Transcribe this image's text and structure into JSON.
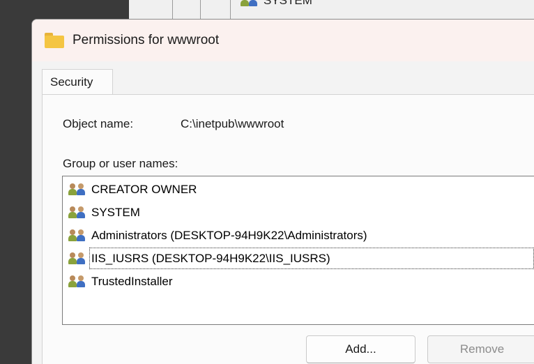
{
  "background": {
    "partial_item": "SYSTEM"
  },
  "dialog": {
    "title": "Permissions for wwwroot",
    "tabs": [
      {
        "label": "Security",
        "active": true
      }
    ],
    "object_name_label": "Object name:",
    "object_name_value": "C:\\inetpub\\wwwroot",
    "group_label": "Group or user names:",
    "users": [
      {
        "name": "CREATOR OWNER",
        "icon": "users-icon"
      },
      {
        "name": "SYSTEM",
        "icon": "users-icon"
      },
      {
        "name": "Administrators (DESKTOP-94H9K22\\Administrators)",
        "icon": "users-icon"
      },
      {
        "name": "IIS_IUSRS (DESKTOP-94H9K22\\IIS_IUSRS)",
        "icon": "users-icon",
        "selected": true
      },
      {
        "name": "TrustedInstaller",
        "icon": "users-icon"
      }
    ],
    "buttons": {
      "add": "Add...",
      "remove": "Remove"
    }
  },
  "colors": {
    "title_bar": "#fbf1ef",
    "folder": "#f4c542",
    "disabled_text": "#8c8c8c"
  }
}
